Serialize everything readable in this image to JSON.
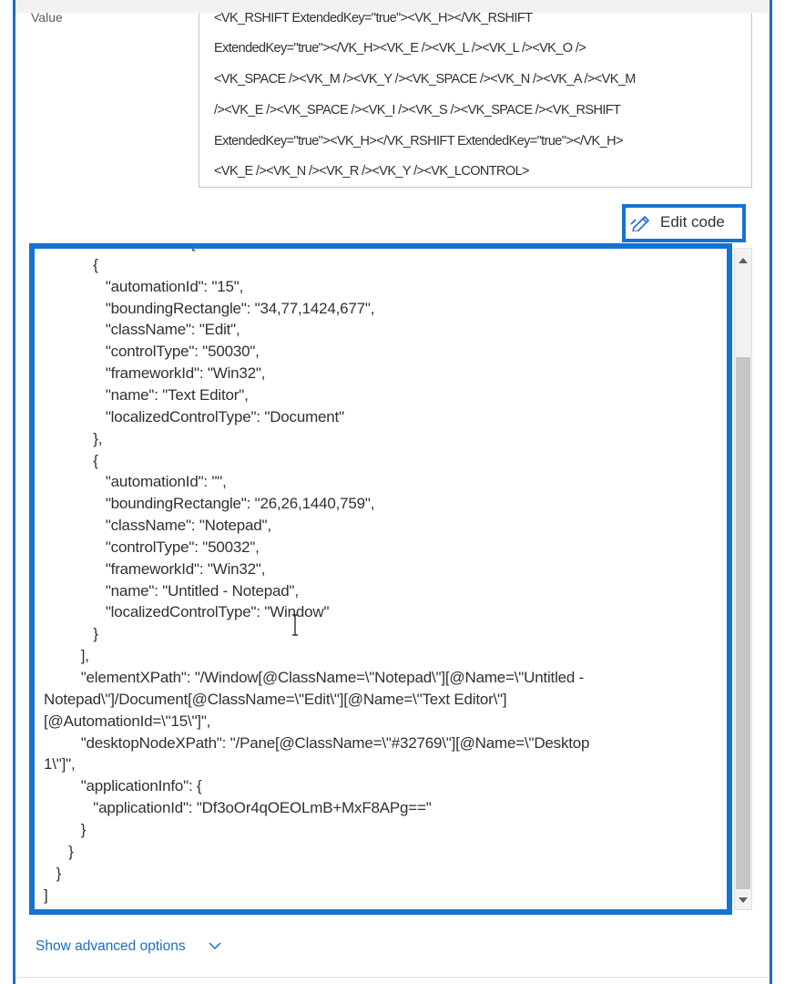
{
  "value_field": {
    "label": "Value",
    "lines": [
      "<VK_RSHIFT ExtendedKey=\"true\"><VK_H></VK_RSHIFT",
      "ExtendedKey=\"true\"></VK_H><VK_E /><VK_L /><VK_L /><VK_O />",
      "<VK_SPACE /><VK_M /><VK_Y /><VK_SPACE /><VK_N /><VK_A /><VK_M",
      "/><VK_E /><VK_SPACE /><VK_I /><VK_S /><VK_SPACE /><VK_RSHIFT",
      "ExtendedKey=\"true\"><VK_H></VK_RSHIFT ExtendedKey=\"true\"></VK_H>",
      "<VK_E /><VK_N /><VK_R /><VK_Y /><VK_LCONTROL>"
    ]
  },
  "toolbar": {
    "edit_code_label": "Edit code",
    "edit_icon": "pencil-icon"
  },
  "code_editor": {
    "lines": [
      "         \"elementStack\": [",
      "            {",
      "               \"automationId\": \"15\",",
      "               \"boundingRectangle\": \"34,77,1424,677\",",
      "               \"className\": \"Edit\",",
      "               \"controlType\": \"50030\",",
      "               \"frameworkId\": \"Win32\",",
      "               \"name\": \"Text Editor\",",
      "               \"localizedControlType\": \"Document\"",
      "            },",
      "            {",
      "               \"automationId\": \"\",",
      "               \"boundingRectangle\": \"26,26,1440,759\",",
      "               \"className\": \"Notepad\",",
      "               \"controlType\": \"50032\",",
      "               \"frameworkId\": \"Win32\",",
      "               \"name\": \"Untitled - Notepad\",",
      "               \"localizedControlType\": \"Window\"",
      "            }",
      "         ],",
      "         \"elementXPath\": \"/Window[@ClassName=\\\"Notepad\\\"][@Name=\\\"Untitled -",
      "Notepad\\\"]/Document[@ClassName=\\\"Edit\\\"][@Name=\\\"Text Editor\\\"]",
      "[@AutomationId=\\\"15\\\"]\",",
      "         \"desktopNodeXPath\": \"/Pane[@ClassName=\\\"#32769\\\"][@Name=\\\"Desktop",
      "1\\\"]\",",
      "         \"applicationInfo\": {",
      "            \"applicationId\": \"Df3oOr4qOEOLmB+MxF8APg==\"",
      "         }",
      "      }",
      "   }",
      "]"
    ]
  },
  "footer": {
    "advanced_label": "Show advanced options",
    "chevron_icon": "chevron-down-icon"
  },
  "colors": {
    "accent": "#1573d2",
    "link": "#1b6ec2",
    "text": "#323130"
  }
}
